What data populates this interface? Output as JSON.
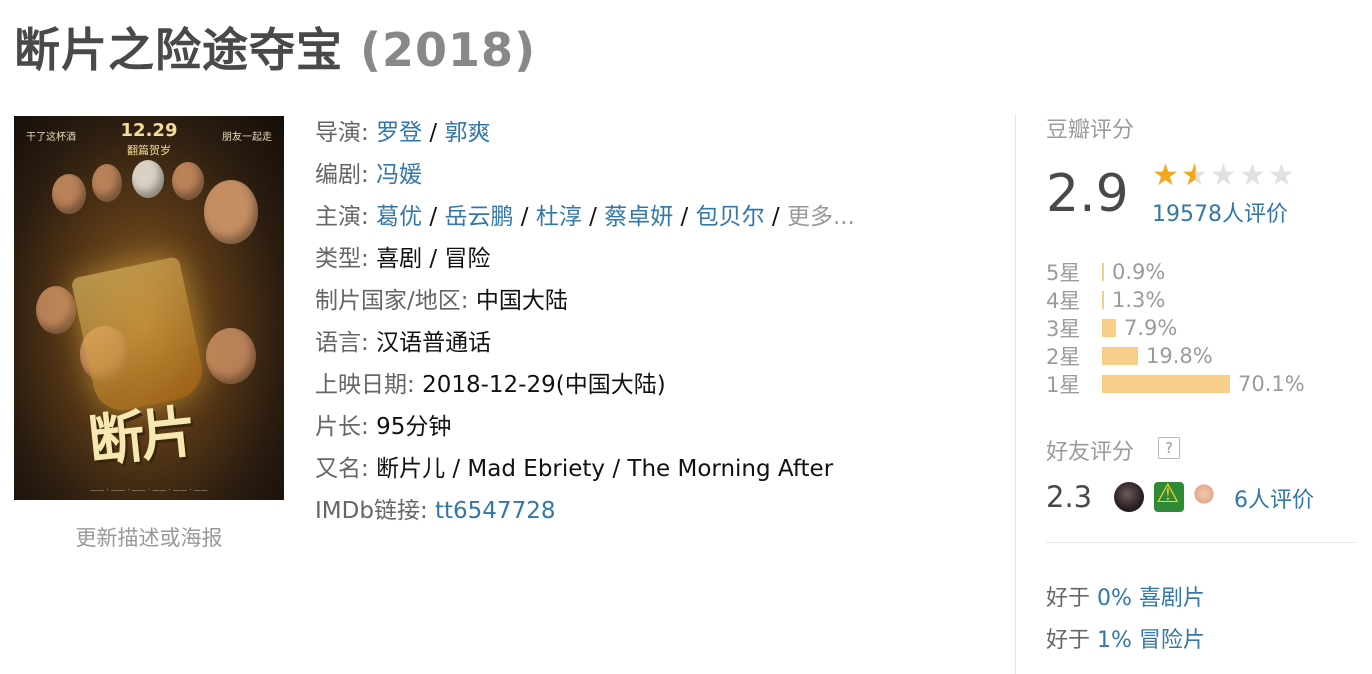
{
  "movie": {
    "title": "断片之险途夺宝",
    "year": "(2018)"
  },
  "poster": {
    "date": "12.29",
    "subtitle": "翻篇贺岁",
    "tag_left": "干了这杯酒",
    "tag_right": "朋友一起走",
    "big_title": "断片",
    "update_link": "更新描述或海报"
  },
  "info": {
    "director_label": "导演",
    "directors": [
      "罗登",
      "郭爽"
    ],
    "writer_label": "编剧",
    "writers": [
      "冯媛"
    ],
    "cast_label": "主演",
    "cast": [
      "葛优",
      "岳云鹏",
      "杜淳",
      "蔡卓妍",
      "包贝尔"
    ],
    "cast_more": "更多...",
    "genre_label": "类型:",
    "genre": "喜剧 / 冒险",
    "country_label": "制片国家/地区:",
    "country": "中国大陆",
    "language_label": "语言:",
    "language": "汉语普通话",
    "release_label": "上映日期:",
    "release": "2018-12-29(中国大陆)",
    "runtime_label": "片长:",
    "runtime": "95分钟",
    "aka_label": "又名:",
    "aka": "断片儿 / Mad Ebriety / The Morning After",
    "imdb_label": "IMDb链接",
    "imdb": "tt6547728"
  },
  "rating": {
    "label": "豆瓣评分",
    "score": "2.9",
    "stars_value": 1.5,
    "votes": "19578人评价",
    "distribution": [
      {
        "label": "5星",
        "pct_text": "0.9%",
        "pct": 0.9
      },
      {
        "label": "4星",
        "pct_text": "1.3%",
        "pct": 1.3
      },
      {
        "label": "3星",
        "pct_text": "7.9%",
        "pct": 7.9
      },
      {
        "label": "2星",
        "pct_text": "19.8%",
        "pct": 19.8
      },
      {
        "label": "1星",
        "pct_text": "70.1%",
        "pct": 70.1
      }
    ],
    "friend_label": "好友评分",
    "friend_help": "?",
    "friend_score": "2.3",
    "friend_votes": "6人评价",
    "better_than": [
      {
        "prefix": "好于",
        "value": "0% 喜剧片"
      },
      {
        "prefix": "好于",
        "value": "1% 冒险片"
      }
    ]
  },
  "colors": {
    "link": "#3377aa",
    "star": "#f2a81c",
    "bar": "#f7cf8b"
  }
}
